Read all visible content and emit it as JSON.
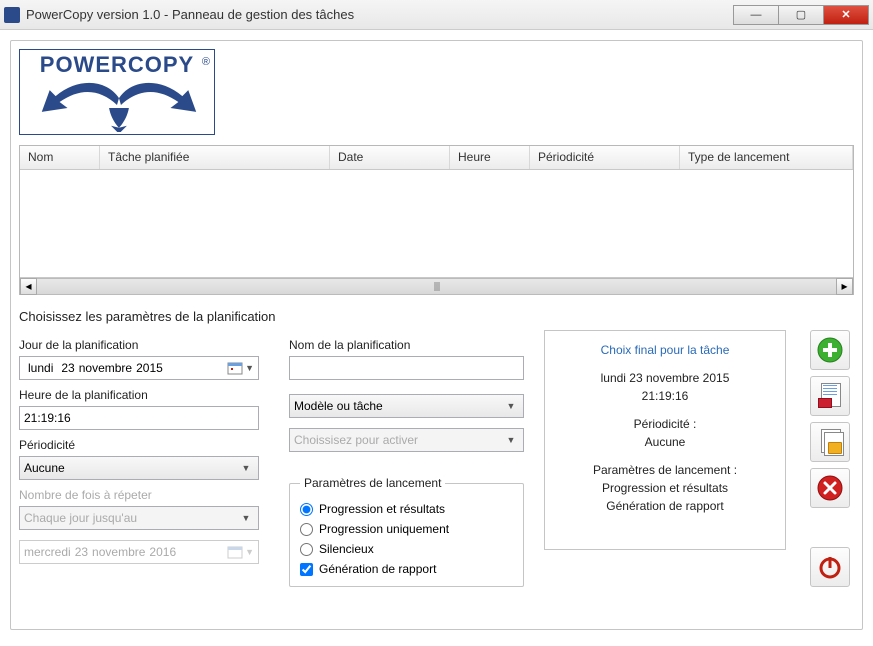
{
  "window": {
    "title": "PowerCopy version 1.0 - Panneau de gestion des tâches"
  },
  "logo": {
    "text": "POWERCOPY"
  },
  "grid": {
    "columns": [
      "Nom",
      "Tâche planifiée",
      "Date",
      "Heure",
      "Périodicité",
      "Type de lancement"
    ],
    "rows": []
  },
  "section_title": "Choisissez les paramètres de la planification",
  "left": {
    "day_label": "Jour de la planification",
    "day_weekday": "lundi",
    "day_day": "23",
    "day_month": "novembre",
    "day_year": "2015",
    "hour_label": "Heure de la planification",
    "hour_value": "21:19:16",
    "period_label": "Périodicité",
    "period_value": "Aucune",
    "repeat_label": "Nombre de fois à répeter",
    "repeat_value": "Chaque jour jusqu'au",
    "until_weekday": "mercredi",
    "until_day": "23",
    "until_month": "novembre",
    "until_year": "2016"
  },
  "mid": {
    "name_label": "Nom de la planification",
    "name_value": "",
    "model_value": "Modèle ou tâche",
    "activate_value": "Choissisez pour activer",
    "launch_legend": "Paramètres de lancement",
    "opt1": "Progression et résultats",
    "opt2": "Progression uniquement",
    "opt3": "Silencieux",
    "chk1": "Génération de rapport"
  },
  "summary": {
    "title": "Choix final pour la tâche",
    "date_line": "lundi 23 novembre 2015",
    "time_line": "21:19:16",
    "period_label": "Périodicité :",
    "period_value": "Aucune",
    "launch_label": "Paramètres de lancement :",
    "launch_v1": "Progression et résultats",
    "launch_v2": "Génération de rapport"
  }
}
